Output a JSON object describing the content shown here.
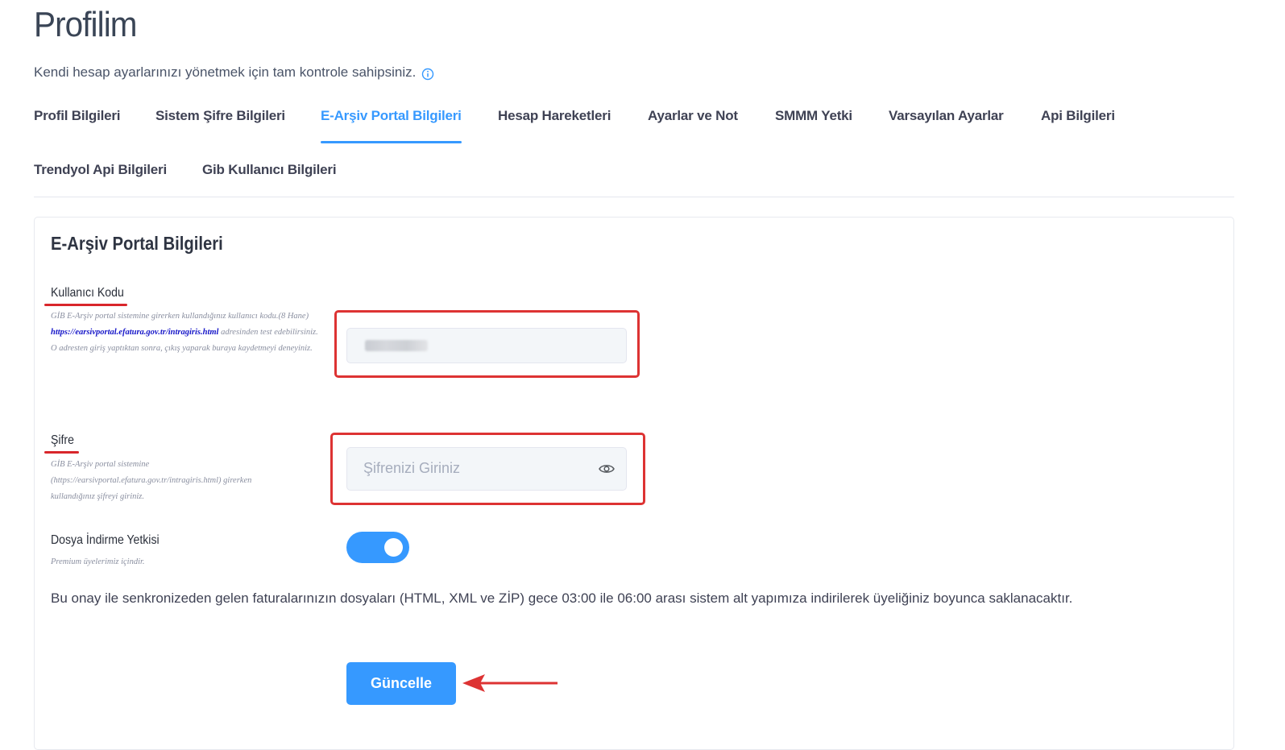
{
  "page": {
    "title": "Profilim",
    "subtitle": "Kendi hesap ayarlarınızı yönetmek için tam kontrole sahipsiniz.",
    "info_icon": "info-circle-icon"
  },
  "tabs": [
    {
      "label": "Profil Bilgileri",
      "active": false
    },
    {
      "label": "Sistem Şifre Bilgileri",
      "active": false
    },
    {
      "label": "E-Arşiv Portal Bilgileri",
      "active": true
    },
    {
      "label": "Hesap Hareketleri",
      "active": false
    },
    {
      "label": "Ayarlar ve Not",
      "active": false
    },
    {
      "label": "SMMM Yetki",
      "active": false
    },
    {
      "label": "Varsayılan Ayarlar",
      "active": false
    },
    {
      "label": "Api Bilgileri",
      "active": false
    },
    {
      "label": "Trendyol Api Bilgileri",
      "active": false
    },
    {
      "label": "Gib Kullanıcı Bilgileri",
      "active": false
    }
  ],
  "card": {
    "title": "E-Arşiv Portal Bilgileri",
    "user_code": {
      "label": "Kullanıcı Kodu",
      "help_1": "GİB E-Arşiv portal sistemine girerken kullandığınız kullanıcı kodu.(8 Hane)",
      "help_link": "https://earsivportal.efatura.gov.tr/intragiris.html",
      "help_2": " adresinden test edebilirsiniz.",
      "help_3": "O adresten giriş yaptıktan sonra, çıkış yaparak buraya kaydetmeyi deneyiniz.",
      "value_masked": true
    },
    "password": {
      "label": "Şifre",
      "help": "GİB E-Arşiv portal sistemine (https://earsivportal.efatura.gov.tr/intragiris.html) girerken kullandığınız şifreyi giriniz.",
      "placeholder": "Şifrenizi Giriniz",
      "value": "",
      "icon": "eye-icon"
    },
    "download": {
      "label": "Dosya İndirme Yetkisi",
      "help": "Premium üyelerimiz içindir.",
      "enabled": true
    },
    "consent_text": "Bu onay ile senkronizeden gelen faturalarınızın dosyaları (HTML, XML ve ZİP) gece 03:00 ile 06:00 arası sistem alt yapımıza indirilerek üyeliğiniz boyunca saklanacaktır.",
    "button_label": "Güncelle"
  },
  "colors": {
    "accent": "#3699ff",
    "annotation": "#dd3333",
    "text": "#3f4254"
  }
}
